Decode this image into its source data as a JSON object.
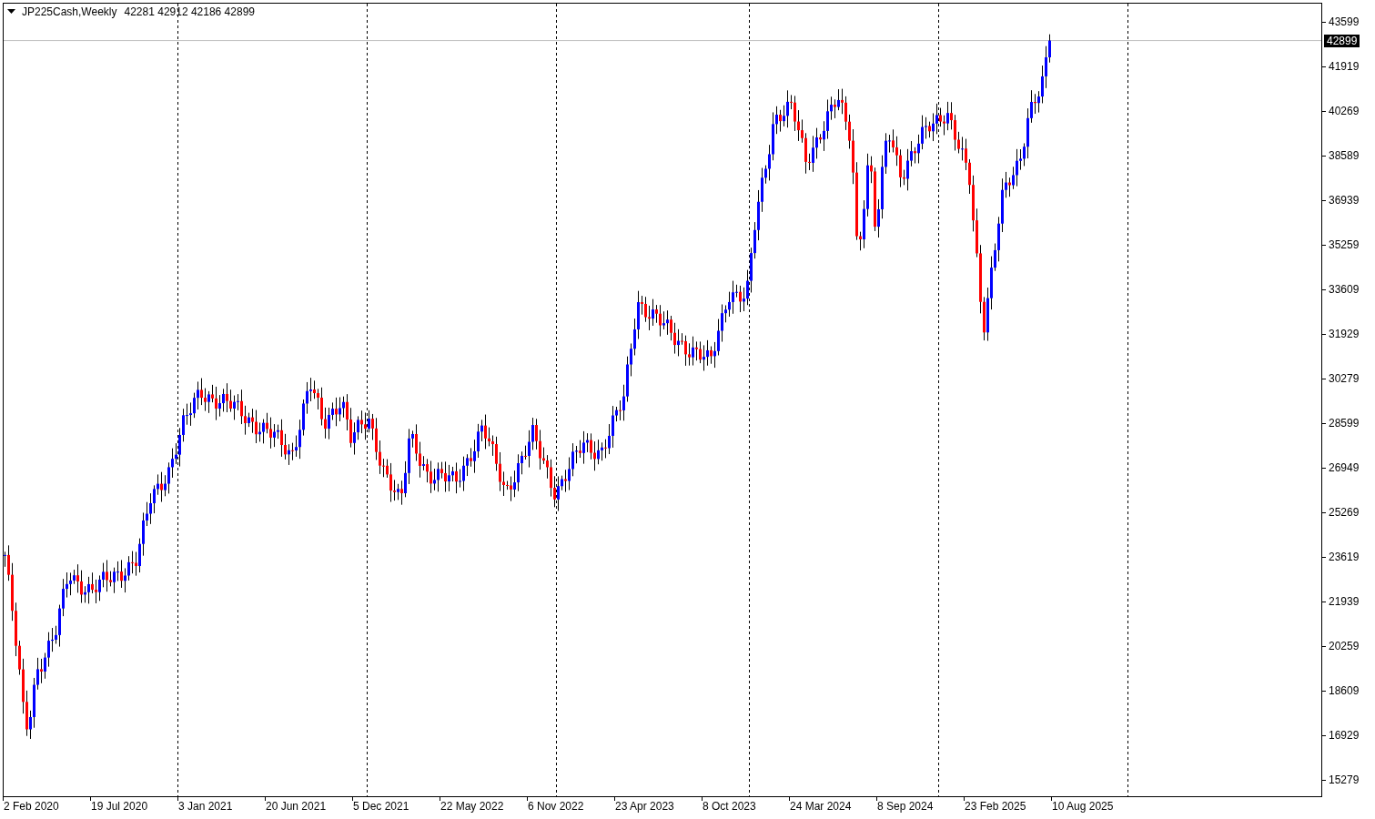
{
  "chart": {
    "symbol_label": "JP225Cash,Weekly",
    "ohlc": "42281 42912 42186 42899",
    "current_price": "42899",
    "y_axis_labels": [
      "43599",
      "41919",
      "40269",
      "38589",
      "36939",
      "35259",
      "33609",
      "31929",
      "30279",
      "28599",
      "26949",
      "25269",
      "23619",
      "21939",
      "20259",
      "18609",
      "16929",
      "15279"
    ],
    "x_axis_labels": [
      "2 Feb 2020",
      "19 Jul 2020",
      "3 Jan 2021",
      "20 Jun 2021",
      "5 Dec 2021",
      "22 May 2022",
      "6 Nov 2022",
      "23 Apr 2023",
      "8 Oct 2023",
      "24 Mar 2024",
      "8 Sep 2024",
      "23 Feb 2025",
      "10 Aug 2025"
    ]
  }
}
